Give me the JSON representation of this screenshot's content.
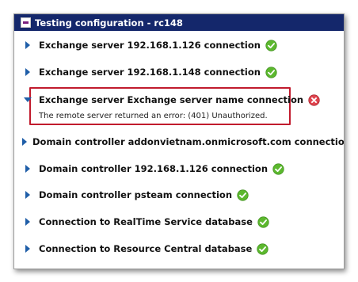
{
  "window": {
    "title": "Testing configuration - rc148"
  },
  "items": [
    {
      "label": "Exchange server 192.168.1.126 connection",
      "expanded": false,
      "status": "success"
    },
    {
      "label": "Exchange server 192.168.1.148 connection",
      "expanded": false,
      "status": "success"
    },
    {
      "label": "Exchange server Exchange server name connection",
      "expanded": true,
      "status": "error",
      "message": "The remote server returned an error: (401) Unauthorized."
    },
    {
      "label": "Domain controller addonvietnam.onmicrosoft.com connection",
      "expanded": false,
      "status": "success"
    },
    {
      "label": "Domain controller 192.168.1.126 connection",
      "expanded": false,
      "status": "success"
    },
    {
      "label": "Domain controller psteam connection",
      "expanded": false,
      "status": "success"
    },
    {
      "label": "Connection to RealTime Service database",
      "expanded": false,
      "status": "success"
    },
    {
      "label": "Connection to Resource Central database",
      "expanded": false,
      "status": "success"
    }
  ],
  "colors": {
    "titlebar_bg": "#14276b",
    "success": "#5cb82e",
    "error": "#e0454f",
    "highlight_border": "#c11b2d",
    "arrow": "#1f5ea8"
  }
}
